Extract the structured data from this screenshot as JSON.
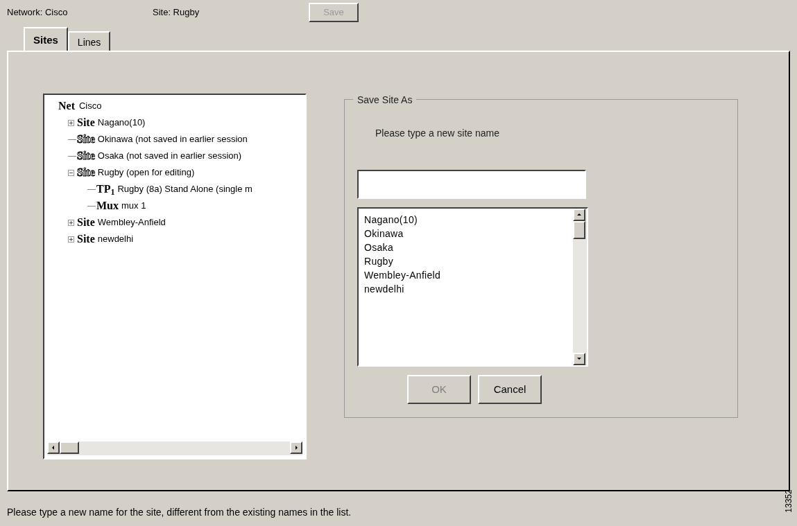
{
  "header": {
    "network": "Network: Cisco",
    "site": "Site: Rugby",
    "save_button": {
      "label": "Save",
      "disabled": true
    }
  },
  "tabs": [
    {
      "label": "Sites",
      "selected": true
    },
    {
      "label": "Lines",
      "selected": false
    }
  ],
  "tree": {
    "root": {
      "tag": "Net",
      "label": "Cisco"
    },
    "items": [
      {
        "tag": "Site",
        "label": "Nagano(10)",
        "kind": "saved",
        "toggle": {
          "expanded": false
        }
      },
      {
        "tag": "Site",
        "label": "Okinawa (not saved in earlier session",
        "kind": "unsaved"
      },
      {
        "tag": "Site",
        "label": "Osaka (not saved in earlier session)",
        "kind": "unsaved"
      },
      {
        "tag": "Site",
        "label": "Rugby (open for editing)",
        "kind": "unsaved",
        "toggle": {
          "expanded": true
        },
        "children": [
          {
            "tag": "TP$_{1}$",
            "label": "Rugby (8a) Stand Alone (single m"
          },
          {
            "tag": "Mux",
            "label": "mux 1"
          }
        ]
      },
      {
        "tag": "Site",
        "label": "Wembley-Anfield",
        "kind": "saved",
        "toggle": {
          "expanded": false
        }
      },
      {
        "tag": "Site",
        "label": "newdelhi",
        "kind": "saved",
        "toggle": {
          "expanded": false
        }
      }
    ]
  },
  "save_site_as": {
    "title": "Save Site As",
    "prompt": "Please type a new site name",
    "existing_names": [
      "Nagano(10)",
      "Okinawa",
      "Osaka",
      "Rugby",
      "Wembley-Anfield",
      "newdelhi"
    ],
    "buttons": [
      {
        "label": "OK",
        "disabled": true
      },
      {
        "label": "Cancel",
        "disabled": false
      }
    ]
  },
  "status_bar": "Please type a new name for the site, different from the existing names in the list.",
  "figure_number": "13352"
}
